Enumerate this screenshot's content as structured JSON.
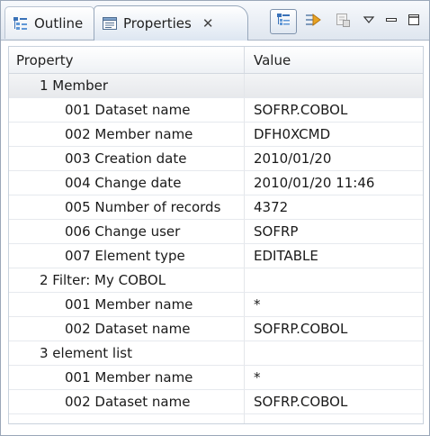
{
  "tabs": [
    {
      "label": "Outline",
      "icon": "outline-icon"
    },
    {
      "label": "Properties",
      "icon": "properties-icon",
      "close": "✕"
    }
  ],
  "toolbar": {
    "icons": [
      "categories-icon",
      "filter-advanced-icon",
      "restore-default-icon",
      "view-menu-icon",
      "minimize-icon",
      "maximize-icon"
    ]
  },
  "table": {
    "headers": [
      "Property",
      "Value"
    ],
    "rows": [
      {
        "label": "1 Member",
        "value": "",
        "level": 0
      },
      {
        "label": "001 Dataset name",
        "value": "SOFRP.COBOL",
        "level": 1
      },
      {
        "label": "002 Member name",
        "value": "DFH0XCMD",
        "level": 1
      },
      {
        "label": "003 Creation date",
        "value": "2010/01/20",
        "level": 1
      },
      {
        "label": "004 Change date",
        "value": "2010/01/20 11:46",
        "level": 1
      },
      {
        "label": "005 Number of records",
        "value": "4372",
        "level": 1
      },
      {
        "label": "006 Change user",
        "value": "SOFRP",
        "level": 1
      },
      {
        "label": "007 Element type",
        "value": "EDITABLE",
        "level": 1
      },
      {
        "label": "2 Filter:  My COBOL",
        "value": "",
        "level": 0
      },
      {
        "label": "001 Member name",
        "value": "*",
        "level": 1
      },
      {
        "label": "002 Dataset name",
        "value": "SOFRP.COBOL",
        "level": 1
      },
      {
        "label": "3 element list",
        "value": "",
        "level": 0
      },
      {
        "label": "001 Member name",
        "value": "*",
        "level": 1
      },
      {
        "label": "002 Dataset name",
        "value": "SOFRP.COBOL",
        "level": 1
      },
      {
        "label": "",
        "value": "",
        "level": 1
      }
    ]
  }
}
